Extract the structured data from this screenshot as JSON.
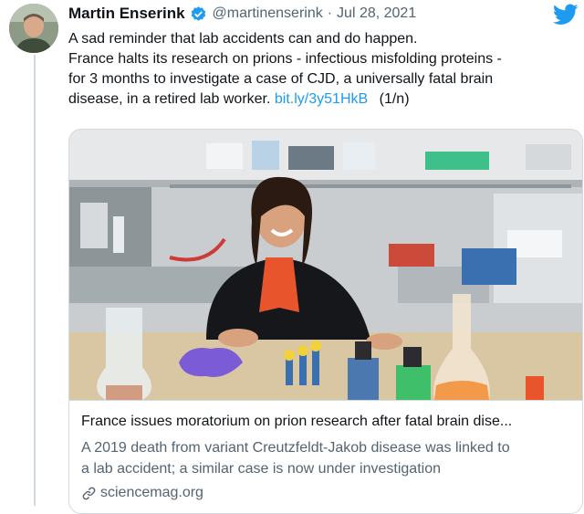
{
  "tweet": {
    "author_name": "Martin Enserink",
    "handle": "@martinenserink",
    "separator": "·",
    "date": "Jul 28, 2021",
    "text_line_1": "A sad reminder that lab accidents can and do happen.",
    "text_line_2": "France halts its research on prions - infectious misfolding proteins -",
    "text_line_3": "for 3 months to investigate a case of CJD, a universally fatal brain",
    "text_line_4_start": "disease, in a retired lab worker.",
    "link_text": "bit.ly/3y51HkB",
    "thread_counter": "(1/n)"
  },
  "card": {
    "title": "France issues moratorium on prion research after fatal brain dise...",
    "description_line_1": "A 2019 death from variant Creutzfeldt-Jakob disease was linked to",
    "description_line_2": "a lab accident; a similar case is now under investigation",
    "domain": "sciencemag.org"
  },
  "colors": {
    "accent": "#1d9bf0",
    "text": "#0f1419",
    "secondary": "#536471",
    "border": "#cfd9de"
  },
  "icons": {
    "verified": "verified-badge-icon",
    "brand": "twitter-bird-icon",
    "link": "link-icon"
  }
}
